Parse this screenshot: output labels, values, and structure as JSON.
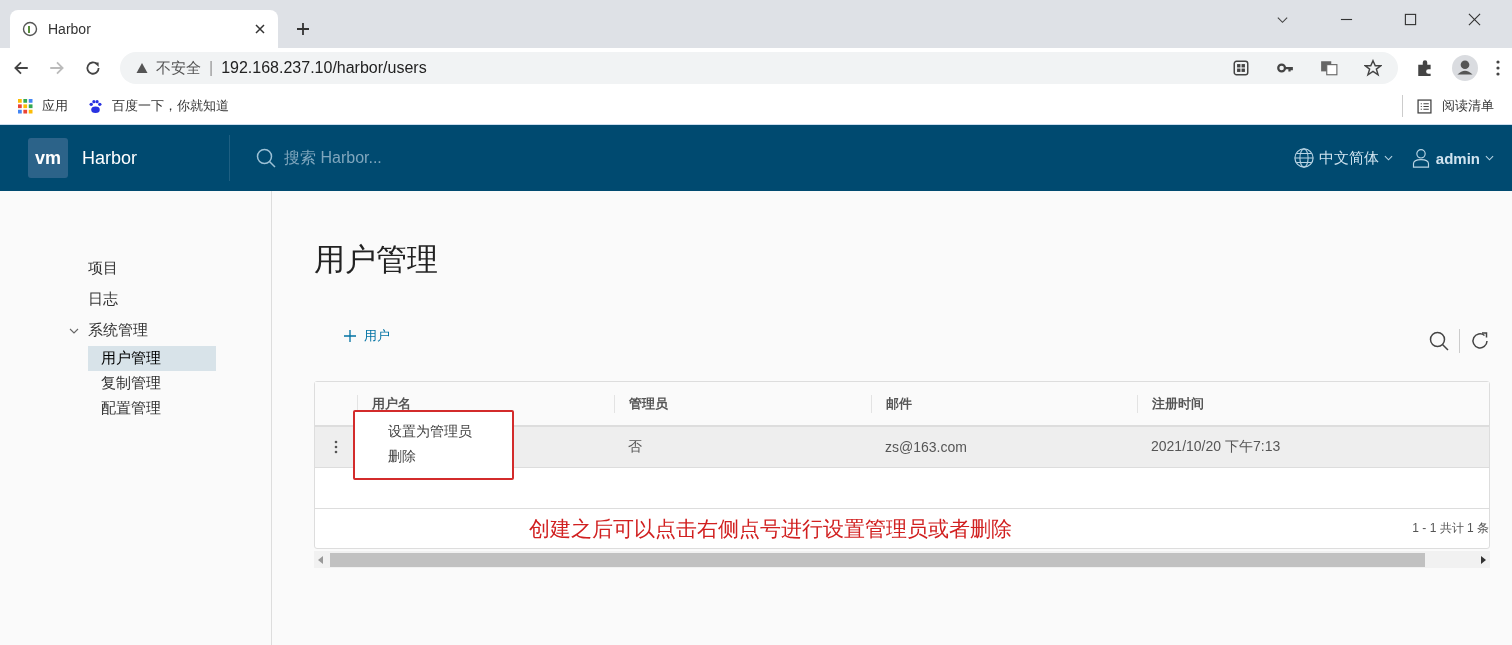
{
  "browser": {
    "tab": {
      "title": "Harbor"
    },
    "address": {
      "security": "不安全",
      "separator": "|",
      "url": "192.168.237.10/harbor/users"
    },
    "bookmarks": [
      {
        "label": "应用",
        "kind": "apps"
      },
      {
        "label": "百度一下，你就知道",
        "kind": "paw"
      }
    ],
    "reading_list": "阅读清单"
  },
  "header": {
    "logo": "vm",
    "brand": "Harbor",
    "search": {
      "placeholder": "搜索 Harbor..."
    },
    "language": "中文简体",
    "user": "admin"
  },
  "sidebar": {
    "items": [
      {
        "label": "项目",
        "selected": false
      },
      {
        "label": "日志",
        "selected": false
      },
      {
        "label": "系统管理",
        "selected": false,
        "expanded": true,
        "children": [
          {
            "label": "用户管理",
            "selected": true
          },
          {
            "label": "复制管理",
            "selected": false
          },
          {
            "label": "配置管理",
            "selected": false
          }
        ]
      }
    ]
  },
  "page": {
    "title": "用户管理",
    "add_button": "用户",
    "table": {
      "columns": [
        "用户名",
        "管理员",
        "邮件",
        "注册时间"
      ],
      "rows": [
        {
          "admin": "否",
          "email": "zs@163.com",
          "registered": "2021/10/20 下午7:13",
          "selected": true
        }
      ],
      "footer": "1 - 1 共计 1 条"
    },
    "context_menu": {
      "items": [
        "设置为管理员",
        "删除"
      ]
    },
    "annotation": "创建之后可以点击右侧点号进行设置管理员或者删除"
  }
}
